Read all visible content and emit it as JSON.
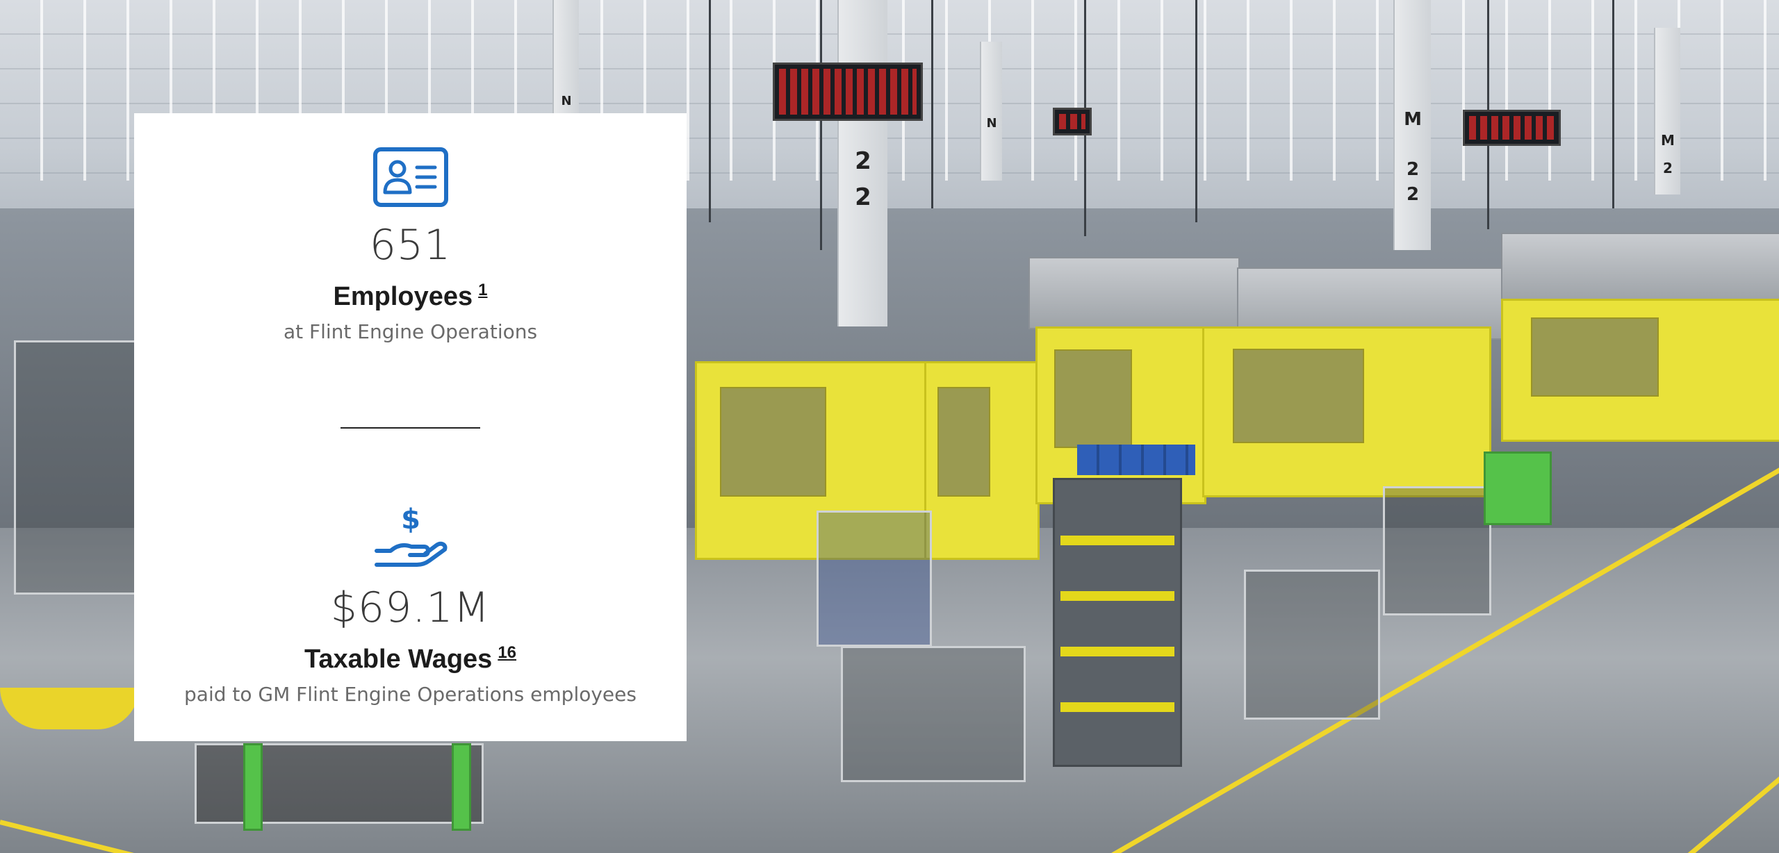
{
  "card": {
    "employees": {
      "icon": "id-card-icon",
      "value": "651",
      "label": "Employees",
      "footnote": "1",
      "description": "at Flint Engine Operations"
    },
    "wages": {
      "icon": "hand-dollar-icon",
      "value": "$69.1M",
      "label": "Taxable Wages",
      "footnote": "16",
      "description": "paid to GM Flint Engine Operations employees"
    }
  },
  "background": {
    "column_tags": [
      "M",
      "2",
      "2",
      "M",
      "2",
      "2",
      "M",
      "2",
      "N",
      "N"
    ]
  },
  "colors": {
    "icon_blue": "#1f6fc5",
    "safety_yellow": "#f0d62a",
    "card_background": "#ffffff"
  }
}
